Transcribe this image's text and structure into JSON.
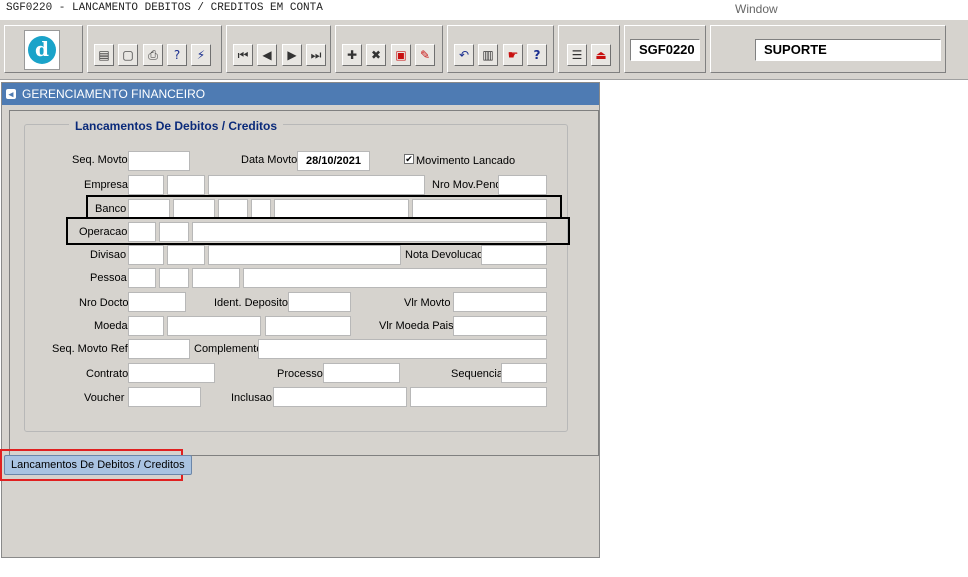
{
  "menubar": {
    "title": "SGF0220 - LANCAMENTO DEBITOS / CREDITOS EM CONTA",
    "window_menu": "Window"
  },
  "toolbar": {
    "module_code": "SGF0220",
    "user": "SUPORTE"
  },
  "window": {
    "title": "GERENCIAMENTO FINANCEIRO"
  },
  "form": {
    "section_title": "Lancamentos De Debitos / Creditos",
    "labels": {
      "seq_movto": "Seq. Movto",
      "data_movto": "Data Movto",
      "movimento_lancado": "Movimento Lancado",
      "empresa": "Empresa",
      "nro_mov_pend": "Nro Mov.Pend",
      "banco": "Banco",
      "operacao": "Operacao",
      "divisao": "Divisao",
      "nota_devolucao": "Nota Devolucao",
      "pessoa": "Pessoa",
      "nro_docto": "Nro Docto",
      "ident_deposito": "Ident. Deposito",
      "vlr_movto": "Vlr Movto",
      "moeda": "Moeda",
      "vlr_moeda_pais": "Vlr Moeda Pais",
      "seq_movto_ref": "Seq. Movto Ref.",
      "complemento": "Complemento",
      "contrato": "Contrato",
      "processo": "Processo",
      "sequencia": "Sequencia",
      "voucher": "Voucher",
      "inclusao": "Inclusao"
    },
    "values": {
      "data_movto": "28/10/2021",
      "movimento_lancado_check": "✔"
    }
  },
  "tabs": [
    {
      "label": "Lancamentos De Debitos / Creditos"
    }
  ],
  "icons": [
    "save-icon",
    "window-icon",
    "print-icon",
    "query-icon",
    "execute-query-icon",
    "first-record-icon",
    "previous-record-icon",
    "next-record-icon",
    "last-record-icon",
    "insert-icon",
    "delete-icon",
    "clear-icon",
    "edit-icon",
    "undo-icon",
    "list-icon",
    "help-hand-icon",
    "help-icon",
    "menu-icon",
    "exit-icon"
  ]
}
